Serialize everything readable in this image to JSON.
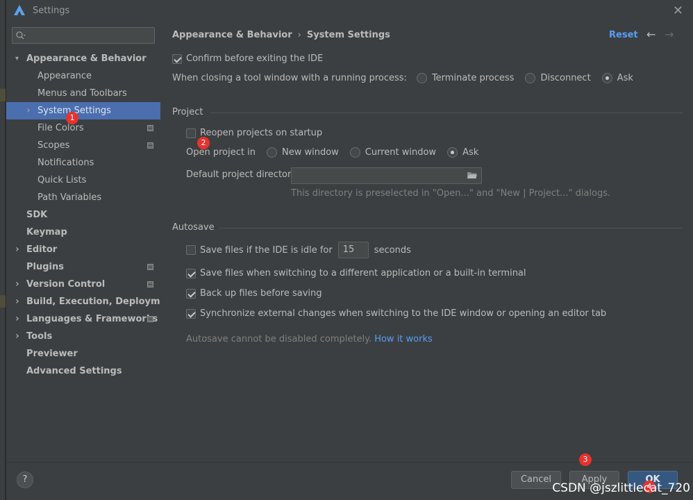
{
  "window": {
    "title": "Settings",
    "close_glyph": "✕"
  },
  "sidebar": {
    "search": {
      "placeholder": ""
    },
    "items": [
      {
        "label": "Appearance & Behavior",
        "bold": true,
        "expandable": true,
        "expanded": true,
        "indent": 0
      },
      {
        "label": "Appearance",
        "indent": 1
      },
      {
        "label": "Menus and Toolbars",
        "indent": 1
      },
      {
        "label": "System Settings",
        "indent": 1,
        "expandable": true,
        "selected": true
      },
      {
        "label": "File Colors",
        "indent": 1,
        "project": true
      },
      {
        "label": "Scopes",
        "indent": 1,
        "project": true
      },
      {
        "label": "Notifications",
        "indent": 1
      },
      {
        "label": "Quick Lists",
        "indent": 1
      },
      {
        "label": "Path Variables",
        "indent": 1
      },
      {
        "label": "SDK",
        "bold": true,
        "indent": 0
      },
      {
        "label": "Keymap",
        "bold": true,
        "indent": 0
      },
      {
        "label": "Editor",
        "bold": true,
        "expandable": true,
        "indent": 0
      },
      {
        "label": "Plugins",
        "bold": true,
        "indent": 0,
        "project": true
      },
      {
        "label": "Version Control",
        "bold": true,
        "expandable": true,
        "indent": 0,
        "project": true
      },
      {
        "label": "Build, Execution, Deployment",
        "bold": true,
        "expandable": true,
        "indent": 0
      },
      {
        "label": "Languages & Frameworks",
        "bold": true,
        "expandable": true,
        "indent": 0,
        "project": true
      },
      {
        "label": "Tools",
        "bold": true,
        "expandable": true,
        "indent": 0
      },
      {
        "label": "Previewer",
        "bold": true,
        "indent": 0
      },
      {
        "label": "Advanced Settings",
        "bold": true,
        "indent": 0
      }
    ]
  },
  "main": {
    "breadcrumb": {
      "parent": "Appearance & Behavior",
      "sep": "›",
      "current": "System Settings"
    },
    "reset_label": "Reset",
    "nav": {
      "back": "←",
      "forward": "→"
    },
    "confirm_exit": {
      "label": "Confirm before exiting the IDE",
      "checked": true
    },
    "closing_tool_window": {
      "label": "When closing a tool window with a running process:",
      "options": [
        "Terminate process",
        "Disconnect",
        "Ask"
      ],
      "selected": "Ask"
    },
    "project": {
      "title": "Project",
      "reopen": {
        "label": "Reopen projects on startup",
        "checked": false
      },
      "open_in": {
        "label": "Open project in",
        "options": [
          "New window",
          "Current window",
          "Ask"
        ],
        "selected": "Ask"
      },
      "default_dir": {
        "label": "Default project directory:",
        "value": "",
        "hint": "This directory is preselected in \"Open...\" and \"New | Project...\" dialogs."
      }
    },
    "autosave": {
      "title": "Autosave",
      "idle": {
        "label_before": "Save files if the IDE is idle for",
        "value": "15",
        "label_after": "seconds",
        "checked": false
      },
      "switching": {
        "label": "Save files when switching to a different application or a built-in terminal",
        "checked": true
      },
      "backup": {
        "label": "Back up files before saving",
        "checked": true
      },
      "sync": {
        "label": "Synchronize external changes when switching to the IDE window or opening an editor tab",
        "checked": true
      },
      "note": "Autosave cannot be disabled completely.",
      "note_link": "How it works"
    }
  },
  "footer": {
    "help": "?",
    "cancel": "Cancel",
    "apply": "Apply",
    "ok": "OK"
  },
  "annotations": [
    "1",
    "2",
    "3",
    "4"
  ],
  "watermark": "CSDN @jszlittlecat_720",
  "colors": {
    "selection": "#4b6eaf",
    "link": "#589df6",
    "primary": "#365880",
    "badge": "#e8322e"
  }
}
